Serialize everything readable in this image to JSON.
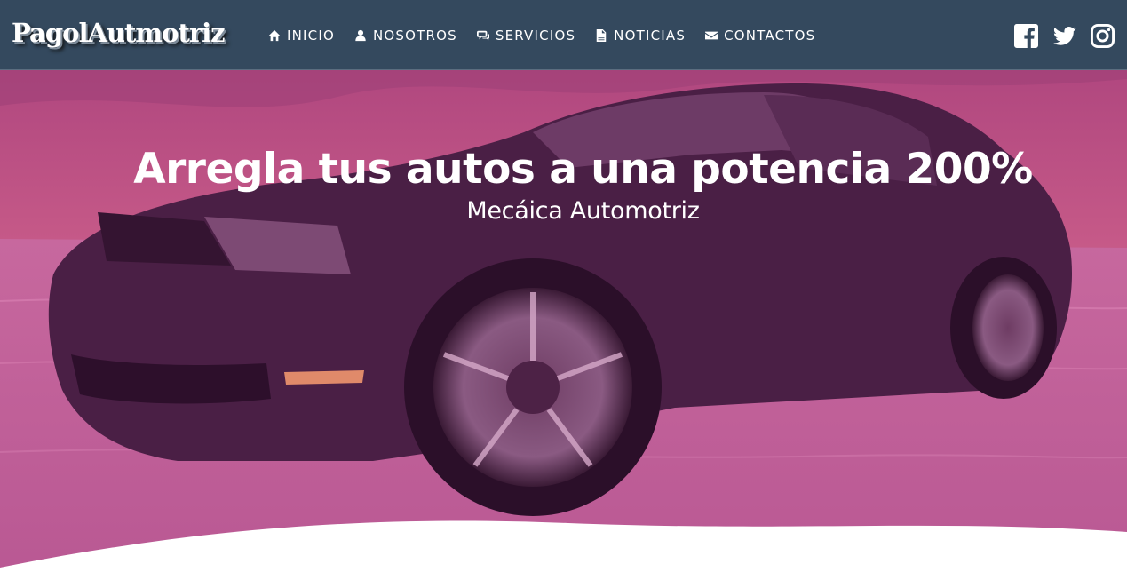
{
  "brand": {
    "name": "PagolAutmotriz"
  },
  "nav": {
    "items": [
      {
        "label": "INICIO",
        "icon": "home-icon"
      },
      {
        "label": "NOSOTROS",
        "icon": "user-icon"
      },
      {
        "label": "SERVICIOS",
        "icon": "comments-icon"
      },
      {
        "label": "NOTICIAS",
        "icon": "file-icon"
      },
      {
        "label": "CONTACTOS",
        "icon": "envelope-icon"
      }
    ]
  },
  "social": [
    "facebook-icon",
    "twitter-icon",
    "instagram-icon"
  ],
  "hero": {
    "title": "Arregla tus autos a una potencia 200%",
    "subtitle": "Mecáica Automotriz",
    "image": "black-sports-car-photo",
    "overlay_color": "#d63a8c"
  },
  "colors": {
    "navbar": "#34495e",
    "text": "#ffffff"
  }
}
